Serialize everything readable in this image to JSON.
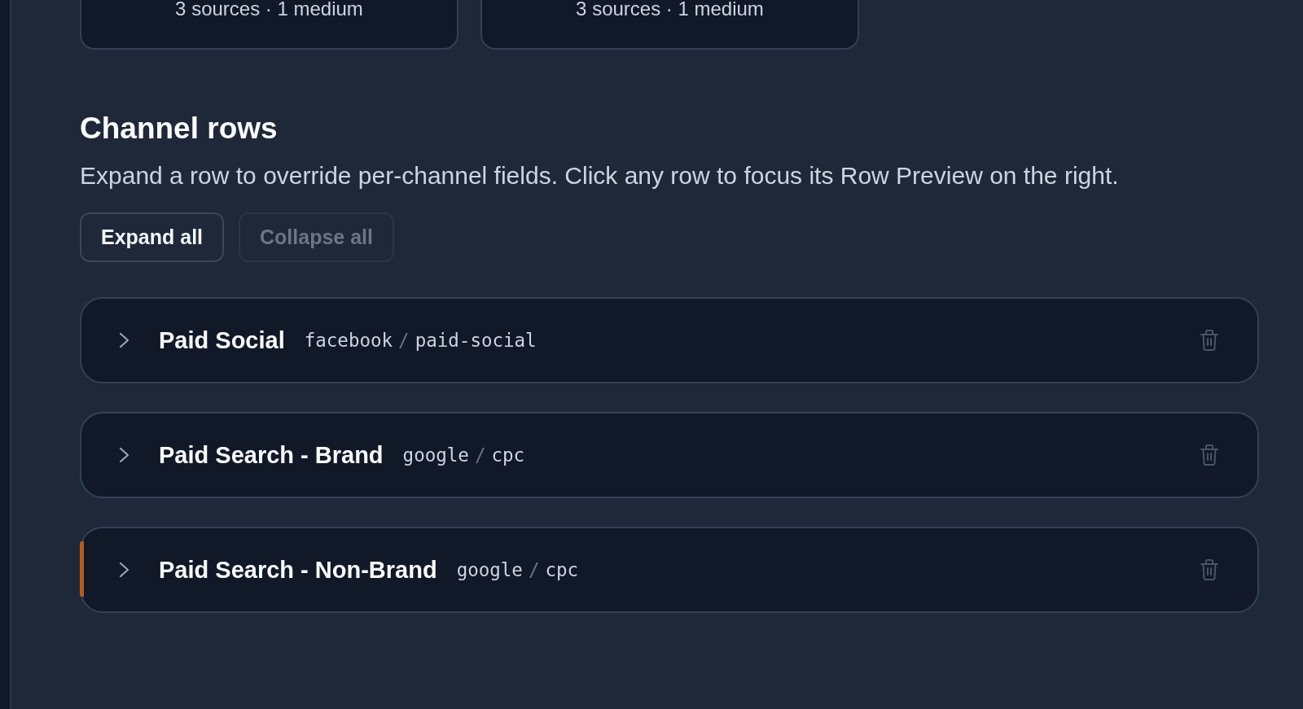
{
  "summary_cards": [
    {
      "caption": "3 sources · 1 medium"
    },
    {
      "caption": "3 sources · 1 medium"
    }
  ],
  "section": {
    "title": "Channel rows",
    "description": "Expand a row to override per-channel fields. Click any row to focus its Row Preview on the right."
  },
  "actions": [
    {
      "label": "Expand all",
      "disabled": false
    },
    {
      "label": "Collapse all",
      "disabled": true
    }
  ],
  "rows": [
    {
      "name": "Paid Social",
      "source": "facebook",
      "separator": "/",
      "medium": "paid-social",
      "expanded": false,
      "selected": false
    },
    {
      "name": "Paid Search - Brand",
      "source": "google",
      "separator": "/",
      "medium": "cpc",
      "expanded": false,
      "selected": false
    },
    {
      "name": "Paid Search - Non-Brand",
      "source": "google",
      "separator": "/",
      "medium": "cpc",
      "expanded": false,
      "selected": true
    }
  ]
}
